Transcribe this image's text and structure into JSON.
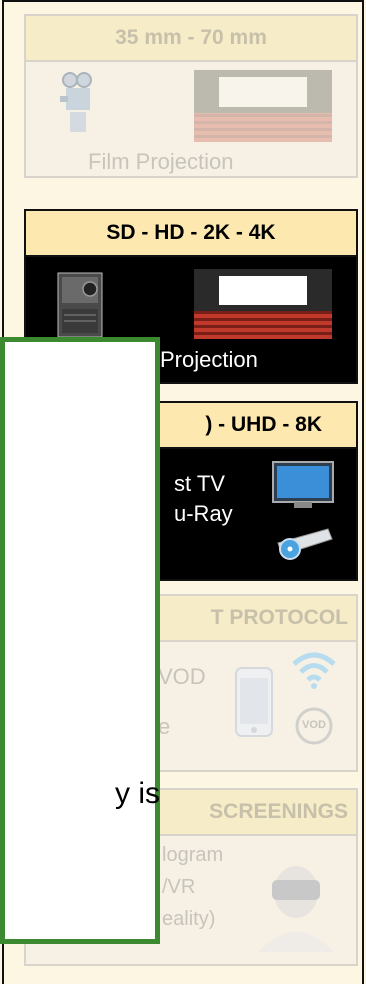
{
  "panels": {
    "film": {
      "header": "35 mm - 70 mm",
      "label": "Film Projection"
    },
    "digital": {
      "header": "SD - HD - 2K - 4K",
      "label": "Projection"
    },
    "broadcast": {
      "header": ") - UHD - 8K",
      "line1": "st  TV",
      "line2": "u-Ray"
    },
    "protocol": {
      "header": "T PROTOCOL",
      "line1": "VOD",
      "line2": "e",
      "vod_badge": "VOD"
    },
    "screenings": {
      "header": "SCREENINGS",
      "line1": "logram",
      "line2": "/VR",
      "line3": "eality)"
    }
  },
  "overlay": {
    "text": "y is"
  },
  "colors": {
    "active_header_bg": "#fde8b0",
    "overlay_border": "#3b8a2f",
    "page_bg": "#fdf6e3"
  }
}
